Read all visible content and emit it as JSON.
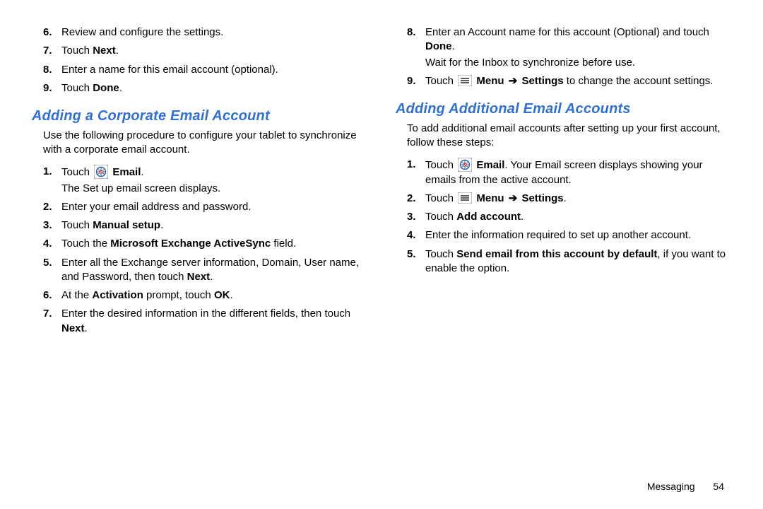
{
  "left": {
    "priorSteps": [
      {
        "n": "6.",
        "text": "Review and configure the settings."
      },
      {
        "n": "7.",
        "prefix": "Touch ",
        "bold": "Next",
        "suffix": "."
      },
      {
        "n": "8.",
        "text": "Enter a name for this email account (optional)."
      },
      {
        "n": "9.",
        "prefix": "Touch ",
        "bold": "Done",
        "suffix": "."
      }
    ],
    "heading": "Adding a Corporate Email Account",
    "intro": "Use the following procedure to configure your tablet to synchronize with a corporate email account.",
    "steps": {
      "s1": {
        "n": "1.",
        "prefix": "Touch ",
        "bold": "Email",
        "suffix": ".",
        "sub": "The Set up email screen displays."
      },
      "s2": {
        "n": "2.",
        "text": "Enter your email address and password."
      },
      "s3": {
        "n": "3.",
        "prefix": "Touch ",
        "bold": "Manual setup",
        "suffix": "."
      },
      "s4": {
        "n": "4.",
        "prefix": "Touch the ",
        "bold": "Microsoft Exchange ActiveSync",
        "suffix": " field."
      },
      "s5": {
        "n": "5.",
        "prefix": "Enter all the Exchange server information, Domain, User name, and Password, then touch ",
        "bold": "Next",
        "suffix": "."
      },
      "s6": {
        "n": "6.",
        "prefix": "At the ",
        "bold1": "Activation",
        "mid": " prompt, touch ",
        "bold2": "OK",
        "suffix": "."
      },
      "s7": {
        "n": "7.",
        "prefix": "Enter the desired information in the different fields, then touch ",
        "bold": "Next",
        "suffix": "."
      }
    }
  },
  "right": {
    "topSteps": {
      "s8": {
        "n": "8.",
        "prefix": "Enter an Account name for this account (Optional) and touch ",
        "bold": "Done",
        "suffix": ".",
        "sub": "Wait for the Inbox to synchronize before use."
      },
      "s9": {
        "n": "9.",
        "prefix": "Touch ",
        "bold1": "Menu",
        "arrow": " ➔ ",
        "bold2": "Settings",
        "suffix": " to change the account settings."
      }
    },
    "heading": "Adding Additional Email Accounts",
    "intro": "To add additional email accounts after setting up your first account, follow these steps:",
    "steps": {
      "s1": {
        "n": "1.",
        "prefix": "Touch ",
        "bold": "Email",
        "suffix": ". Your Email screen displays showing your emails from the active account."
      },
      "s2": {
        "n": "2.",
        "prefix": "Touch ",
        "bold1": "Menu",
        "arrow": " ➔ ",
        "bold2": "Settings",
        "suffix": "."
      },
      "s3": {
        "n": "3.",
        "prefix": "Touch ",
        "bold": "Add account",
        "suffix": "."
      },
      "s4": {
        "n": "4.",
        "text": "Enter the information required to set up another account."
      },
      "s5": {
        "n": "5.",
        "prefix": "Touch ",
        "bold": "Send email from this account by default",
        "suffix": ", if you want to enable the option."
      }
    }
  },
  "footer": {
    "section": "Messaging",
    "page": "54"
  }
}
